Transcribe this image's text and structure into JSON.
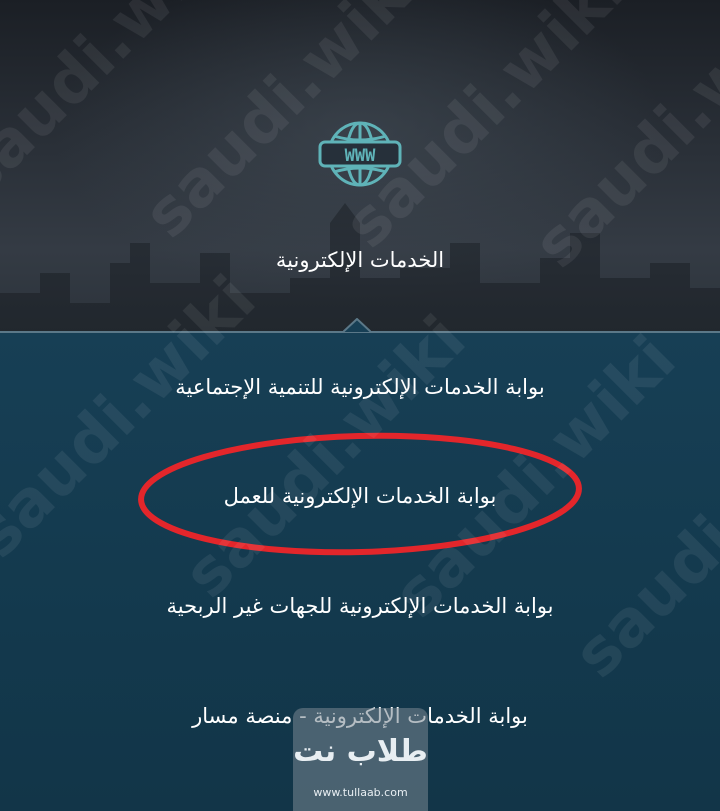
{
  "hero": {
    "icon": "www-globe-icon",
    "title": "الخدمات الإلكترونية"
  },
  "menu": {
    "items": [
      {
        "label": "بوابة الخدمات الإلكترونية للتنمية الإجتماعية"
      },
      {
        "label": "بوابة الخدمات الإلكترونية للعمل"
      },
      {
        "label": "بوابة الخدمات الإلكترونية للجهات غير الربحية"
      },
      {
        "label": "بوابة الخدمات الإلكترونية - منصة مسار"
      }
    ]
  },
  "watermark": {
    "text": "saudi.wiki"
  },
  "logo": {
    "name": "طلاب نت",
    "url": "www.tullaab.com"
  },
  "colors": {
    "accent_icon": "#5fb3b8",
    "highlight": "#e3262b",
    "menu_bg": "#153b50"
  }
}
